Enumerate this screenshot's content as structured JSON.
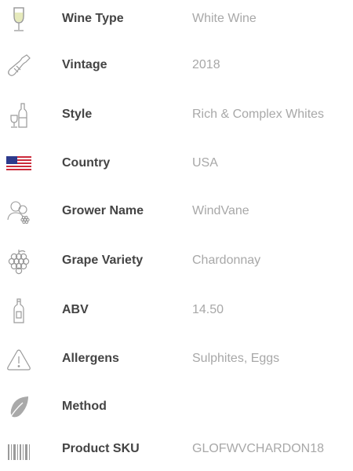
{
  "specs": [
    {
      "icon": "wine-glass-icon",
      "label": "Wine Type",
      "value": "White Wine"
    },
    {
      "icon": "bottle-icon",
      "label": "Vintage",
      "value": "2018"
    },
    {
      "icon": "bottle-and-glass-icon",
      "label": "Style",
      "value": "Rich & Complex Whites"
    },
    {
      "icon": "usa-flag-icon",
      "label": "Country",
      "value": "USA"
    },
    {
      "icon": "growers-icon",
      "label": "Grower Name",
      "value": "WindVane"
    },
    {
      "icon": "grapes-icon",
      "label": "Grape Variety",
      "value": "Chardonnay"
    },
    {
      "icon": "abv-bottle-icon",
      "label": "ABV",
      "value": "14.50"
    },
    {
      "icon": "warning-icon",
      "label": "Allergens",
      "value": "Sulphites, Eggs"
    },
    {
      "icon": "leaf-icon",
      "label": "Method",
      "value": ""
    },
    {
      "icon": "barcode-icon",
      "label": "Product SKU",
      "value": "GLOFWVCHARDON18"
    }
  ],
  "colors": {
    "label": "#444444",
    "value": "#a8a8a8",
    "icon": "#9a9a9a",
    "flag_red": "#cc2b3b",
    "flag_blue": "#2d3a8c"
  }
}
